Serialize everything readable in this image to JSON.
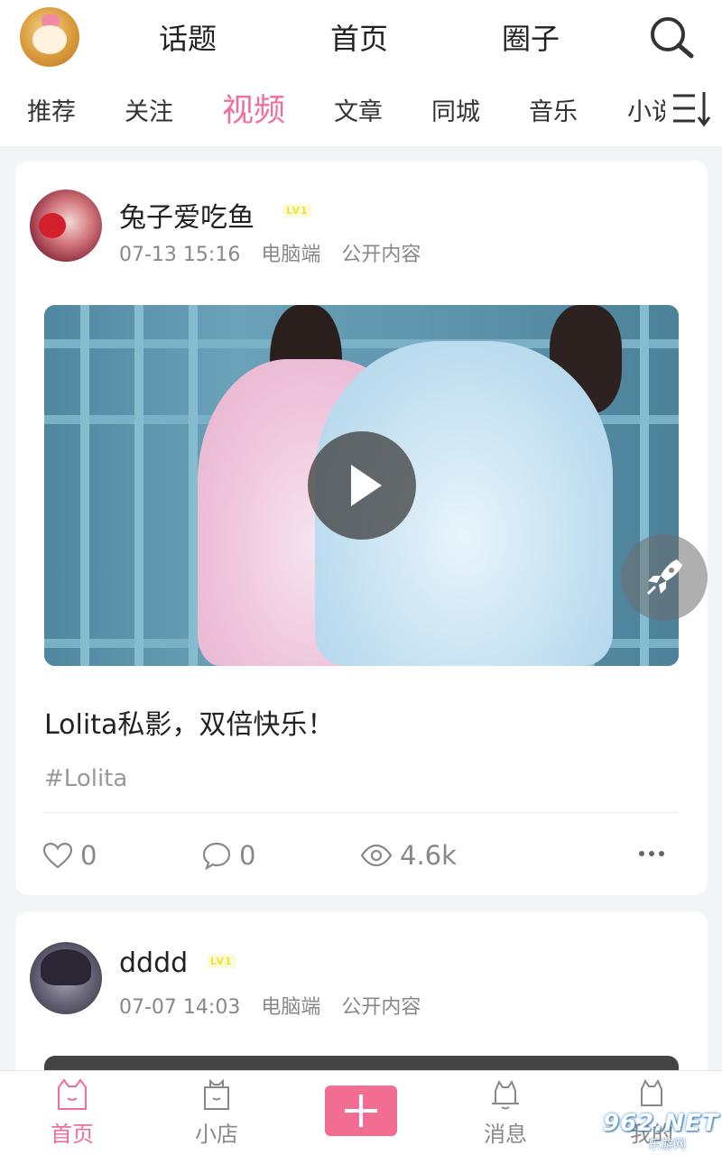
{
  "header": {
    "tabs": [
      "话题",
      "首页",
      "圈子"
    ]
  },
  "subtabs": [
    "推荐",
    "关注",
    "视频",
    "文章",
    "同城",
    "音乐",
    "小说"
  ],
  "active_subtab": "视频",
  "posts": [
    {
      "username": "兔子爱吃鱼",
      "level": "LV1",
      "date": "07-13 15:16",
      "device": "电脑端",
      "visibility": "公开内容",
      "title": "Lolita私影，双倍快乐！",
      "tag": "#Lolita",
      "likes": "0",
      "comments": "0",
      "views": "4.6k"
    },
    {
      "username": "dddd",
      "level": "LV1",
      "date": "07-07 14:03",
      "device": "电脑端",
      "visibility": "公开内容"
    }
  ],
  "bottom_nav": {
    "items": [
      "首页",
      "小店",
      "消息",
      "我的"
    ],
    "active": "首页"
  },
  "watermark": {
    "brand": "962.NET",
    "sub": "乐游网"
  },
  "colors": {
    "accent_pink": "#f06e9c",
    "add_button": "#f26d92",
    "level_badge": "#f3e03a"
  }
}
